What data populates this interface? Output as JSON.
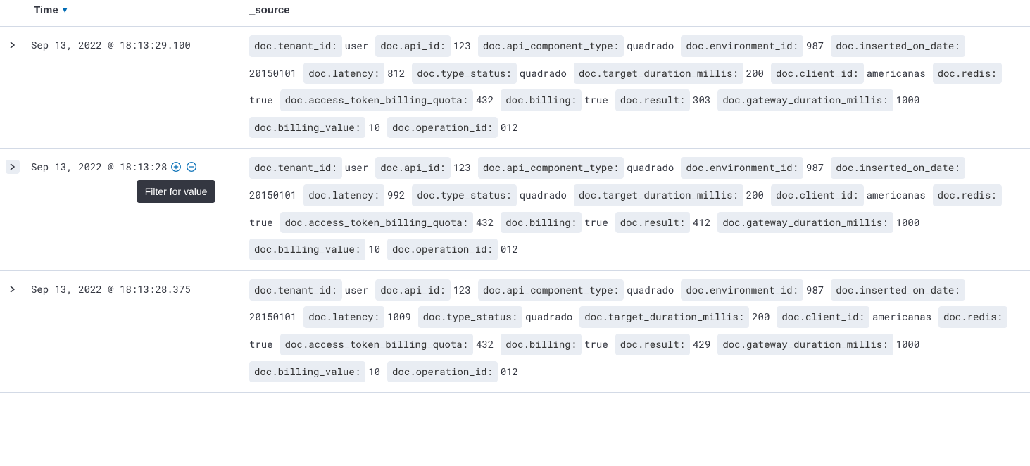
{
  "headers": {
    "time": "Time",
    "source": "_source"
  },
  "tooltip": "Filter for value",
  "rows": [
    {
      "time": "Sep 13, 2022 @ 18:13:29.100",
      "hovered": false,
      "fields": [
        {
          "k": "doc.tenant_id:",
          "v": "user"
        },
        {
          "k": "doc.api_id:",
          "v": "123"
        },
        {
          "k": "doc.api_component_type:",
          "v": "quadrado"
        },
        {
          "k": "doc.environment_id:",
          "v": "987"
        },
        {
          "k": "doc.inserted_on_date:",
          "v": "20150101"
        },
        {
          "k": "doc.latency:",
          "v": "812"
        },
        {
          "k": "doc.type_status:",
          "v": "quadrado"
        },
        {
          "k": "doc.target_duration_millis:",
          "v": "200"
        },
        {
          "k": "doc.client_id:",
          "v": "americanas"
        },
        {
          "k": "doc.redis:",
          "v": "true"
        },
        {
          "k": "doc.access_token_billing_quota:",
          "v": "432"
        },
        {
          "k": "doc.billing:",
          "v": "true"
        },
        {
          "k": "doc.result:",
          "v": "303"
        },
        {
          "k": "doc.gateway_duration_millis:",
          "v": "1000"
        },
        {
          "k": "doc.billing_value:",
          "v": "10"
        },
        {
          "k": "doc.operation_id:",
          "v": "012"
        }
      ]
    },
    {
      "time": "Sep 13, 2022 @ 18:13:28",
      "hovered": true,
      "fields": [
        {
          "k": "doc.tenant_id:",
          "v": "user"
        },
        {
          "k": "doc.api_id:",
          "v": "123"
        },
        {
          "k": "doc.api_component_type:",
          "v": "quadrado"
        },
        {
          "k": "doc.environment_id:",
          "v": "987"
        },
        {
          "k": "doc.inserted_on_date:",
          "v": "20150101"
        },
        {
          "k": "doc.latency:",
          "v": "992"
        },
        {
          "k": "doc.type_status:",
          "v": "quadrado"
        },
        {
          "k": "doc.target_duration_millis:",
          "v": "200"
        },
        {
          "k": "doc.client_id:",
          "v": "americanas"
        },
        {
          "k": "doc.redis:",
          "v": "true"
        },
        {
          "k": "doc.access_token_billing_quota:",
          "v": "432"
        },
        {
          "k": "doc.billing:",
          "v": "true"
        },
        {
          "k": "doc.result:",
          "v": "412"
        },
        {
          "k": "doc.gateway_duration_millis:",
          "v": "1000"
        },
        {
          "k": "doc.billing_value:",
          "v": "10"
        },
        {
          "k": "doc.operation_id:",
          "v": "012"
        }
      ]
    },
    {
      "time": "Sep 13, 2022 @ 18:13:28.375",
      "hovered": false,
      "fields": [
        {
          "k": "doc.tenant_id:",
          "v": "user"
        },
        {
          "k": "doc.api_id:",
          "v": "123"
        },
        {
          "k": "doc.api_component_type:",
          "v": "quadrado"
        },
        {
          "k": "doc.environment_id:",
          "v": "987"
        },
        {
          "k": "doc.inserted_on_date:",
          "v": "20150101"
        },
        {
          "k": "doc.latency:",
          "v": "1009"
        },
        {
          "k": "doc.type_status:",
          "v": "quadrado"
        },
        {
          "k": "doc.target_duration_millis:",
          "v": "200"
        },
        {
          "k": "doc.client_id:",
          "v": "americanas"
        },
        {
          "k": "doc.redis:",
          "v": "true"
        },
        {
          "k": "doc.access_token_billing_quota:",
          "v": "432"
        },
        {
          "k": "doc.billing:",
          "v": "true"
        },
        {
          "k": "doc.result:",
          "v": "429"
        },
        {
          "k": "doc.gateway_duration_millis:",
          "v": "1000"
        },
        {
          "k": "doc.billing_value:",
          "v": "10"
        },
        {
          "k": "doc.operation_id:",
          "v": "012"
        }
      ]
    }
  ]
}
